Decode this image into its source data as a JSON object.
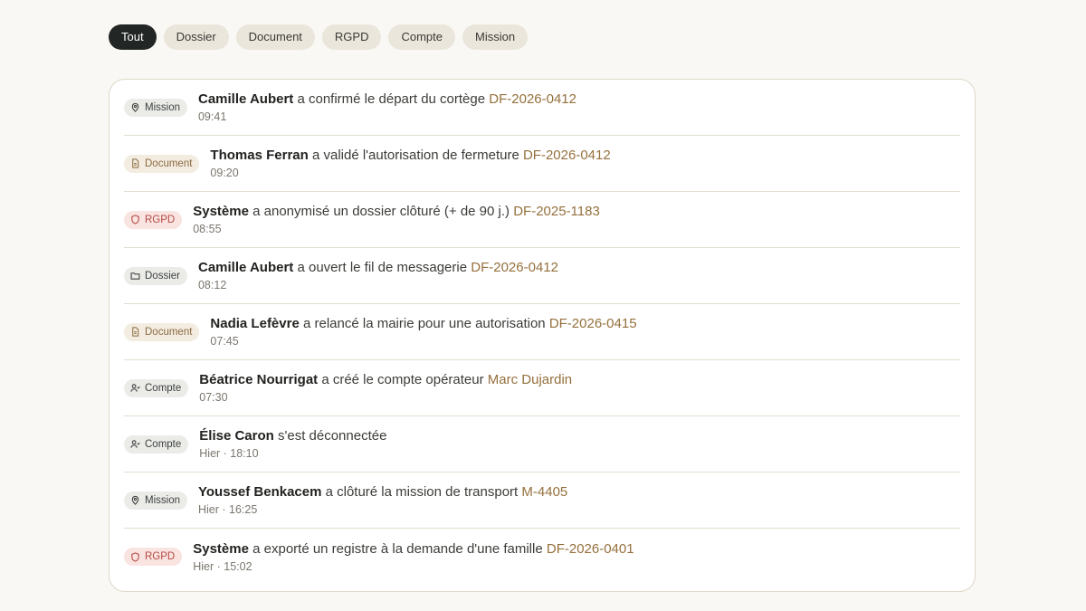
{
  "filters": [
    {
      "label": "Tout",
      "active": true
    },
    {
      "label": "Dossier",
      "active": false
    },
    {
      "label": "Document",
      "active": false
    },
    {
      "label": "RGPD",
      "active": false
    },
    {
      "label": "Compte",
      "active": false
    },
    {
      "label": "Mission",
      "active": false
    }
  ],
  "activity": [
    {
      "type": "Mission",
      "icon": "map-pin-icon",
      "actor": "Camille Aubert",
      "action": "a confirmé le départ du cortège",
      "ref": "DF-2026-0412",
      "time": "09:41"
    },
    {
      "type": "Document",
      "icon": "file-text-icon",
      "actor": "Thomas Ferran",
      "action": "a validé l'autorisation de fermeture",
      "ref": "DF-2026-0412",
      "time": "09:20"
    },
    {
      "type": "RGPD",
      "icon": "shield-icon",
      "actor": "Système",
      "action": "a anonymisé un dossier clôturé (+ de 90 j.)",
      "ref": "DF-2025-1183",
      "time": "08:55"
    },
    {
      "type": "Dossier",
      "icon": "folder-icon",
      "actor": "Camille Aubert",
      "action": "a ouvert le fil de messagerie",
      "ref": "DF-2026-0412",
      "time": "08:12"
    },
    {
      "type": "Document",
      "icon": "file-text-icon",
      "actor": "Nadia Lefèvre",
      "action": "a relancé la mairie pour une autorisation",
      "ref": "DF-2026-0415",
      "time": "07:45"
    },
    {
      "type": "Compte",
      "icon": "user-icon",
      "actor": "Béatrice Nourrigat",
      "action": "a créé le compte opérateur",
      "ref": "Marc Dujardin",
      "time": "07:30"
    },
    {
      "type": "Compte",
      "icon": "user-icon",
      "actor": "Élise Caron",
      "action": "s'est déconnectée",
      "ref": "",
      "time": "Hier · 18:10"
    },
    {
      "type": "Mission",
      "icon": "map-pin-icon",
      "actor": "Youssef Benkacem",
      "action": "a clôturé la mission de transport",
      "ref": "M-4405",
      "time": "Hier · 16:25"
    },
    {
      "type": "RGPD",
      "icon": "shield-icon",
      "actor": "Système",
      "action": "a exporté un registre à la demande d'une famille",
      "ref": "DF-2026-0401",
      "time": "Hier · 15:02"
    }
  ]
}
